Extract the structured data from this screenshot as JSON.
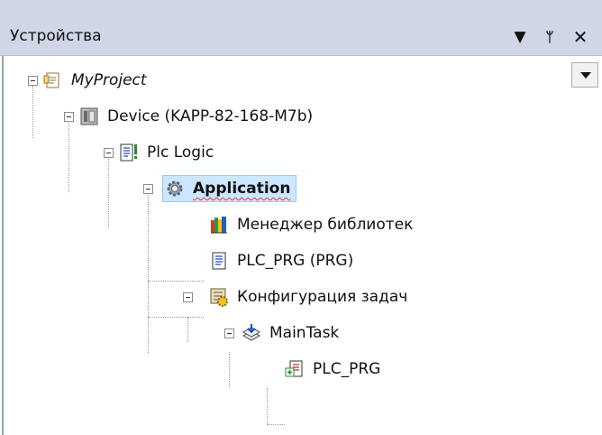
{
  "panel": {
    "title": "Устройства",
    "buttons": {
      "dropdown": "▼",
      "pin": "ᛘ",
      "close": "✕"
    }
  },
  "tree": {
    "project": {
      "label": "MyProject",
      "icon": "project-icon"
    },
    "device": {
      "label": "Device (KAPP-82-168-M7b)",
      "icon": "device-icon"
    },
    "plc_logic": {
      "label": "Plc Logic",
      "icon": "plc-logic-icon"
    },
    "application": {
      "label": "Application",
      "icon": "gear-icon",
      "selected": true
    },
    "library_manager": {
      "label": "Менеджер библиотек",
      "icon": "library-icon"
    },
    "plc_prg": {
      "label": "PLC_PRG (PRG)",
      "icon": "pou-icon"
    },
    "task_config": {
      "label": "Конфигурация задач",
      "icon": "task-config-icon"
    },
    "main_task": {
      "label": "MainTask",
      "icon": "task-icon"
    },
    "task_plc_prg": {
      "label": "PLC_PRG",
      "icon": "program-call-icon"
    }
  },
  "colors": {
    "titlebar": "#cfd6e5",
    "selection_bg": "#cce8ff",
    "selection_border": "#99c9ef"
  }
}
